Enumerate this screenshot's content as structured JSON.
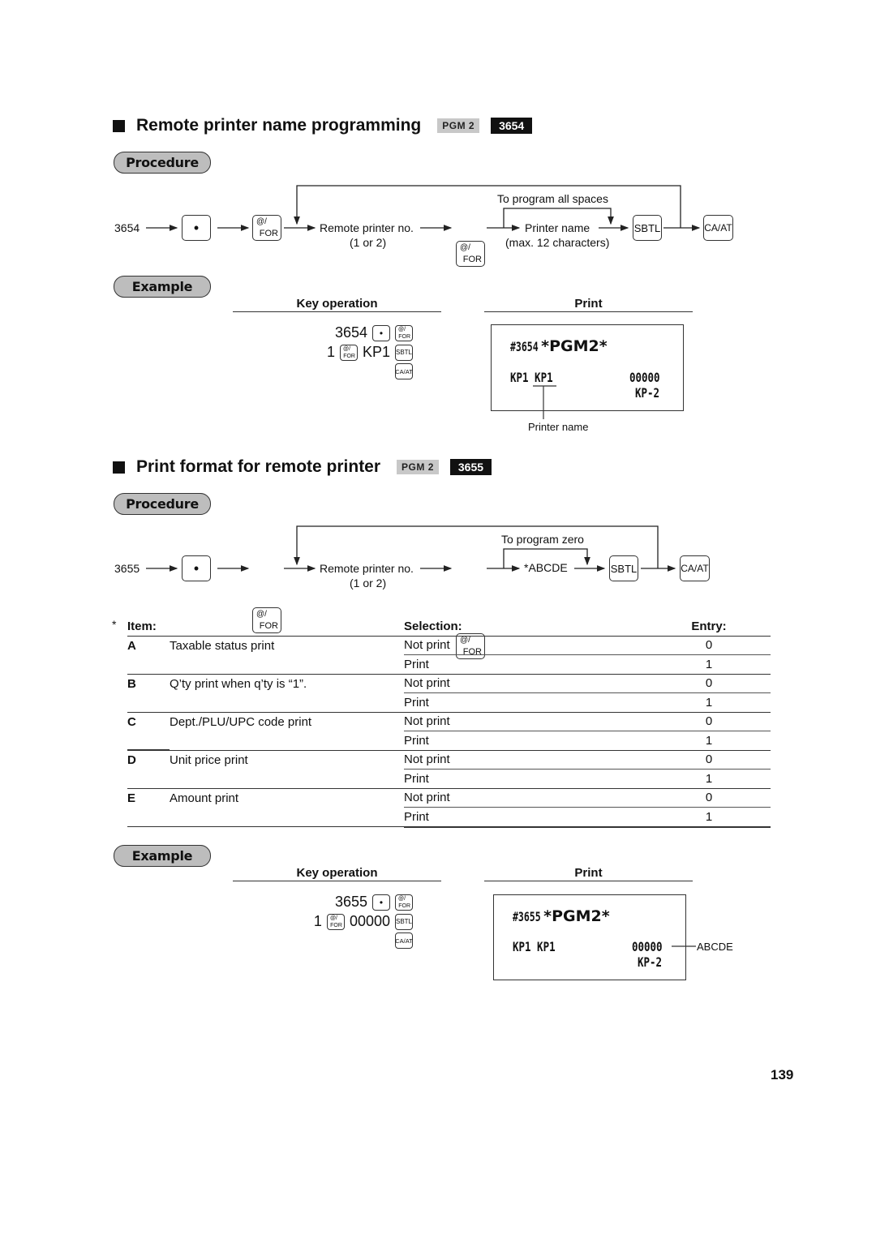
{
  "section1": {
    "title": "Remote printer name programming",
    "pgm_tag": "PGM 2",
    "code_tag": "3654",
    "procedure_label": "Procedure",
    "flow": {
      "start": "3654",
      "key_dot": "•",
      "key_for_top": "@/",
      "key_for_bottom": "FOR",
      "step1": "Remote printer no.",
      "step1_sub": "(1 or 2)",
      "bypass_label": "To program all spaces",
      "step2": "Printer name",
      "step2_sub": "(max. 12 characters)",
      "key_sbtl": "SBTL",
      "key_caat": "CA/AT"
    },
    "example_label": "Example",
    "key_operation_header": "Key operation",
    "print_header": "Print",
    "key_operation": {
      "line1_text": "3654",
      "line2_prefix": "1",
      "line2_text": "KP1"
    },
    "receipt": {
      "line1_code": "#3654",
      "line1_mode": "*PGM2*",
      "line2_left": "KP1 KP1",
      "line2_right": "00000",
      "line3_right": "KP-2"
    },
    "callout": "Printer name"
  },
  "section2": {
    "title": "Print format for remote printer",
    "pgm_tag": "PGM 2",
    "code_tag": "3655",
    "procedure_label": "Procedure",
    "flow": {
      "start": "3655",
      "key_dot": "•",
      "key_for_top": "@/",
      "key_for_bottom": "FOR",
      "step1": "Remote printer no.",
      "step1_sub": "(1 or 2)",
      "bypass_label": "To program zero",
      "step2": "*ABCDE",
      "key_sbtl": "SBTL",
      "key_caat": "CA/AT"
    },
    "table": {
      "asterisk": "*",
      "headers": {
        "item": "Item:",
        "selection": "Selection:",
        "entry": "Entry:"
      },
      "rows": [
        {
          "letter": "A",
          "item": "Taxable status print",
          "options": [
            {
              "selection": "Not print",
              "entry": "0"
            },
            {
              "selection": "Print",
              "entry": "1"
            }
          ]
        },
        {
          "letter": "B",
          "item": "Q’ty print when q’ty is “1”.",
          "options": [
            {
              "selection": "Not print",
              "entry": "0"
            },
            {
              "selection": "Print",
              "entry": "1"
            }
          ]
        },
        {
          "letter": "C",
          "item": "Dept./PLU/UPC code print",
          "options": [
            {
              "selection": "Not print",
              "entry": "0"
            },
            {
              "selection": "Print",
              "entry": "1"
            }
          ]
        },
        {
          "letter": "D",
          "item": "Unit price print",
          "options": [
            {
              "selection": "Not print",
              "entry": "0"
            },
            {
              "selection": "Print",
              "entry": "1"
            }
          ]
        },
        {
          "letter": "E",
          "item": "Amount print",
          "options": [
            {
              "selection": "Not print",
              "entry": "0"
            },
            {
              "selection": "Print",
              "entry": "1"
            }
          ]
        }
      ]
    },
    "example_label": "Example",
    "key_operation_header": "Key operation",
    "print_header": "Print",
    "key_operation": {
      "line1_text": "3655",
      "line2_prefix": "1",
      "line2_text": "00000"
    },
    "receipt": {
      "line1_code": "#3655",
      "line1_mode": "*PGM2*",
      "line2_left": "KP1 KP1",
      "line2_right": "00000",
      "line3_right": "KP-2"
    },
    "callout": "ABCDE"
  },
  "page_number": "139"
}
